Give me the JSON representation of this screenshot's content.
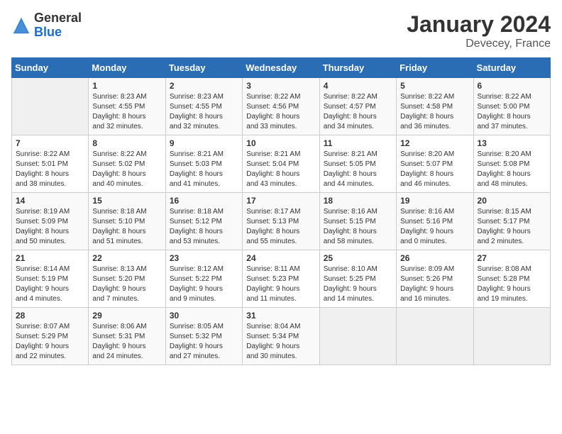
{
  "header": {
    "logo_general": "General",
    "logo_blue": "Blue",
    "month": "January 2024",
    "location": "Devecey, France"
  },
  "weekdays": [
    "Sunday",
    "Monday",
    "Tuesday",
    "Wednesday",
    "Thursday",
    "Friday",
    "Saturday"
  ],
  "weeks": [
    [
      {
        "day": "",
        "info": ""
      },
      {
        "day": "1",
        "info": "Sunrise: 8:23 AM\nSunset: 4:55 PM\nDaylight: 8 hours\nand 32 minutes."
      },
      {
        "day": "2",
        "info": "Sunrise: 8:23 AM\nSunset: 4:55 PM\nDaylight: 8 hours\nand 32 minutes."
      },
      {
        "day": "3",
        "info": "Sunrise: 8:22 AM\nSunset: 4:56 PM\nDaylight: 8 hours\nand 33 minutes."
      },
      {
        "day": "4",
        "info": "Sunrise: 8:22 AM\nSunset: 4:57 PM\nDaylight: 8 hours\nand 34 minutes."
      },
      {
        "day": "5",
        "info": "Sunrise: 8:22 AM\nSunset: 4:58 PM\nDaylight: 8 hours\nand 36 minutes."
      },
      {
        "day": "6",
        "info": "Sunrise: 8:22 AM\nSunset: 5:00 PM\nDaylight: 8 hours\nand 37 minutes."
      }
    ],
    [
      {
        "day": "7",
        "info": "Sunrise: 8:22 AM\nSunset: 5:01 PM\nDaylight: 8 hours\nand 38 minutes."
      },
      {
        "day": "8",
        "info": "Sunrise: 8:22 AM\nSunset: 5:02 PM\nDaylight: 8 hours\nand 40 minutes."
      },
      {
        "day": "9",
        "info": "Sunrise: 8:21 AM\nSunset: 5:03 PM\nDaylight: 8 hours\nand 41 minutes."
      },
      {
        "day": "10",
        "info": "Sunrise: 8:21 AM\nSunset: 5:04 PM\nDaylight: 8 hours\nand 43 minutes."
      },
      {
        "day": "11",
        "info": "Sunrise: 8:21 AM\nSunset: 5:05 PM\nDaylight: 8 hours\nand 44 minutes."
      },
      {
        "day": "12",
        "info": "Sunrise: 8:20 AM\nSunset: 5:07 PM\nDaylight: 8 hours\nand 46 minutes."
      },
      {
        "day": "13",
        "info": "Sunrise: 8:20 AM\nSunset: 5:08 PM\nDaylight: 8 hours\nand 48 minutes."
      }
    ],
    [
      {
        "day": "14",
        "info": "Sunrise: 8:19 AM\nSunset: 5:09 PM\nDaylight: 8 hours\nand 50 minutes."
      },
      {
        "day": "15",
        "info": "Sunrise: 8:18 AM\nSunset: 5:10 PM\nDaylight: 8 hours\nand 51 minutes."
      },
      {
        "day": "16",
        "info": "Sunrise: 8:18 AM\nSunset: 5:12 PM\nDaylight: 8 hours\nand 53 minutes."
      },
      {
        "day": "17",
        "info": "Sunrise: 8:17 AM\nSunset: 5:13 PM\nDaylight: 8 hours\nand 55 minutes."
      },
      {
        "day": "18",
        "info": "Sunrise: 8:16 AM\nSunset: 5:15 PM\nDaylight: 8 hours\nand 58 minutes."
      },
      {
        "day": "19",
        "info": "Sunrise: 8:16 AM\nSunset: 5:16 PM\nDaylight: 9 hours\nand 0 minutes."
      },
      {
        "day": "20",
        "info": "Sunrise: 8:15 AM\nSunset: 5:17 PM\nDaylight: 9 hours\nand 2 minutes."
      }
    ],
    [
      {
        "day": "21",
        "info": "Sunrise: 8:14 AM\nSunset: 5:19 PM\nDaylight: 9 hours\nand 4 minutes."
      },
      {
        "day": "22",
        "info": "Sunrise: 8:13 AM\nSunset: 5:20 PM\nDaylight: 9 hours\nand 7 minutes."
      },
      {
        "day": "23",
        "info": "Sunrise: 8:12 AM\nSunset: 5:22 PM\nDaylight: 9 hours\nand 9 minutes."
      },
      {
        "day": "24",
        "info": "Sunrise: 8:11 AM\nSunset: 5:23 PM\nDaylight: 9 hours\nand 11 minutes."
      },
      {
        "day": "25",
        "info": "Sunrise: 8:10 AM\nSunset: 5:25 PM\nDaylight: 9 hours\nand 14 minutes."
      },
      {
        "day": "26",
        "info": "Sunrise: 8:09 AM\nSunset: 5:26 PM\nDaylight: 9 hours\nand 16 minutes."
      },
      {
        "day": "27",
        "info": "Sunrise: 8:08 AM\nSunset: 5:28 PM\nDaylight: 9 hours\nand 19 minutes."
      }
    ],
    [
      {
        "day": "28",
        "info": "Sunrise: 8:07 AM\nSunset: 5:29 PM\nDaylight: 9 hours\nand 22 minutes."
      },
      {
        "day": "29",
        "info": "Sunrise: 8:06 AM\nSunset: 5:31 PM\nDaylight: 9 hours\nand 24 minutes."
      },
      {
        "day": "30",
        "info": "Sunrise: 8:05 AM\nSunset: 5:32 PM\nDaylight: 9 hours\nand 27 minutes."
      },
      {
        "day": "31",
        "info": "Sunrise: 8:04 AM\nSunset: 5:34 PM\nDaylight: 9 hours\nand 30 minutes."
      },
      {
        "day": "",
        "info": ""
      },
      {
        "day": "",
        "info": ""
      },
      {
        "day": "",
        "info": ""
      }
    ]
  ]
}
